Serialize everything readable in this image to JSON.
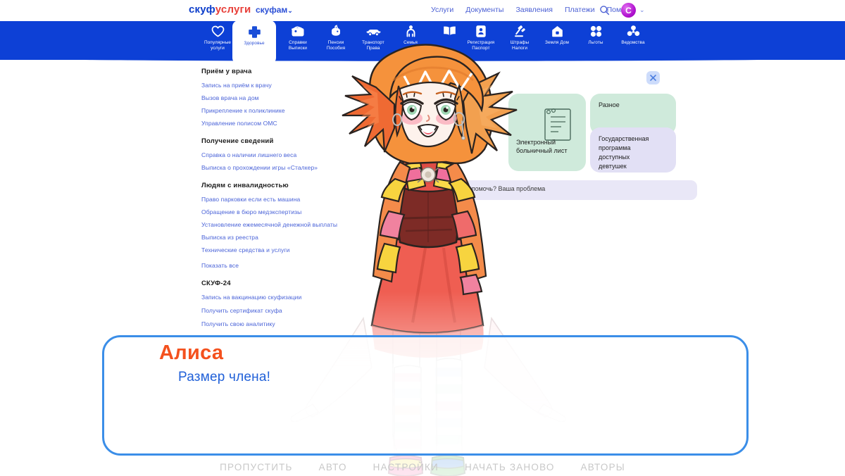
{
  "site": {
    "logo_part_blue": "скуф",
    "logo_part_red": "услуги",
    "logo_sub": "скуфам",
    "logo_sub_chevron": "⌄"
  },
  "topnav": {
    "items": [
      {
        "label": "Услуги"
      },
      {
        "label": "Документы"
      },
      {
        "label": "Заявления"
      },
      {
        "label": "Платежи"
      },
      {
        "label": "Помощь"
      }
    ],
    "search_icon": "search-icon",
    "avatar_initial": "C",
    "avatar_chevron": "⌄"
  },
  "categories": [
    {
      "label": "Популярные\nуслуги",
      "icon": "heart-icon",
      "active": false
    },
    {
      "label": "Здоровье",
      "icon": "cross-icon",
      "active": true
    },
    {
      "label": "Справки\nВыписки",
      "icon": "folder-icon",
      "active": false
    },
    {
      "label": "Пенсии\nПособия",
      "icon": "money-icon",
      "active": false
    },
    {
      "label": "Транспорт\nПрава",
      "icon": "car-icon",
      "active": false
    },
    {
      "label": "Семья",
      "icon": "family-icon",
      "active": false
    },
    {
      "label": "",
      "icon": "book-icon",
      "active": false
    },
    {
      "label": "Регистрация\nПаспорт",
      "icon": "passport-icon",
      "active": false
    },
    {
      "label": "Штрафы\nНалоги",
      "icon": "gavel-icon",
      "active": false
    },
    {
      "label": "Земля Дом",
      "icon": "home-icon",
      "active": false
    },
    {
      "label": "Льготы",
      "icon": "puzzle-icon",
      "active": false
    },
    {
      "label": "Ведомства",
      "icon": "org-icon",
      "active": false
    }
  ],
  "panel": {
    "groups": [
      {
        "title": "Приём у врача",
        "links": [
          "Запись на приём к врачу",
          "Вызов врача на дом",
          "Прикрепление к поликлинике",
          "Управление полисом ОМС"
        ]
      },
      {
        "title": "Получение сведений",
        "links": [
          "Справка о наличии лишнего веса",
          "Выписка о прохождении игры «Сталкер»"
        ]
      },
      {
        "title": "Людям с инвалидностью",
        "links": [
          "Право парковки если есть машина",
          "Обращение в бюро медэкспертизы",
          "Установление ежемесячной денежной выплаты",
          "Выписка из реестра",
          "Технические средства и услуги"
        ]
      }
    ],
    "show_all": "Показать все",
    "last_group": {
      "title": "СКУФ-24",
      "links": [
        "Запись на вакцинацию скуфизации",
        "Получить сертификат скуфа",
        "Получить свою аналитику"
      ]
    }
  },
  "cards": {
    "sick_leave": "Электронный\nбольничный лист",
    "misc": "Разное",
    "program": "Государственная\nпрограмма\nдоступных\nдевтушек"
  },
  "search": {
    "placeholder": "Чем помочь? Ваша проблема"
  },
  "close_button": {
    "icon": "close-icon"
  },
  "dialog": {
    "speaker": "Алиса",
    "text": "Размер члена!"
  },
  "bottom_menu": {
    "items": [
      "ПРОПУСТИТЬ",
      "АВТО",
      "НАСТРОЙКИ",
      "НАЧАТЬ ЗАНОВО",
      "АВТОРЫ"
    ]
  },
  "colors": {
    "banner_blue": "#0d40d6",
    "logo_blue": "#0d3ecb",
    "logo_red": "#e8403a",
    "link_blue": "#4a63d8",
    "dialog_border": "#3b8ee8",
    "speaker_orange": "#f4511e",
    "dialog_text_blue": "#2060d8",
    "card_green": "#cfeadb",
    "card_lilac": "#e2e0f5",
    "avatar_purple": "#b012cf"
  }
}
